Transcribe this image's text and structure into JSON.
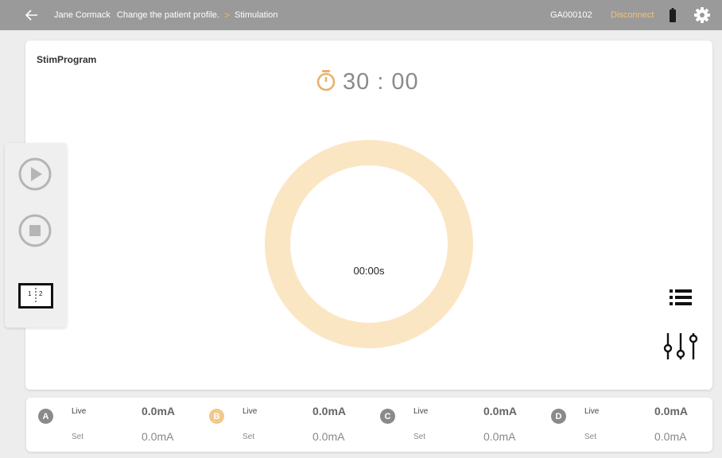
{
  "header": {
    "patient_name": "Jane Cormack",
    "breadcrumb_link": "Change the patient profile.",
    "breadcrumb_separator": ">",
    "current_page": "Stimulation",
    "device_id": "GA000102",
    "disconnect_label": "Disconnect",
    "icons": [
      "back-arrow-icon",
      "battery-icon",
      "gear-icon"
    ]
  },
  "program": {
    "title": "StimProgram",
    "timer_value": "30 : 00",
    "ring_label": "00:00s",
    "accent_color": "#e7b36a",
    "ring_color": "#fbe6c4"
  },
  "side_controls": {
    "icons": [
      "play-icon",
      "stop-icon",
      "layout-split-icon"
    ],
    "layout_label_1": "1",
    "layout_label_2": "2"
  },
  "channels": [
    {
      "id": "A",
      "color": "#8a8a8a",
      "live_label": "Live",
      "live_value": "0.0mA",
      "set_label": "Set",
      "set_value": "0.0mA"
    },
    {
      "id": "B",
      "color": "#f3c889",
      "live_label": "Live",
      "live_value": "0.0mA",
      "set_label": "Set",
      "set_value": "0.0mA"
    },
    {
      "id": "C",
      "color": "#8a8a8a",
      "live_label": "Live",
      "live_value": "0.0mA",
      "set_label": "Set",
      "set_value": "0.0mA"
    },
    {
      "id": "D",
      "color": "#8a8a8a",
      "live_label": "Live",
      "live_value": "0.0mA",
      "set_label": "Set",
      "set_value": "0.0mA"
    }
  ],
  "right_icons": [
    "list-icon",
    "sliders-icon"
  ]
}
